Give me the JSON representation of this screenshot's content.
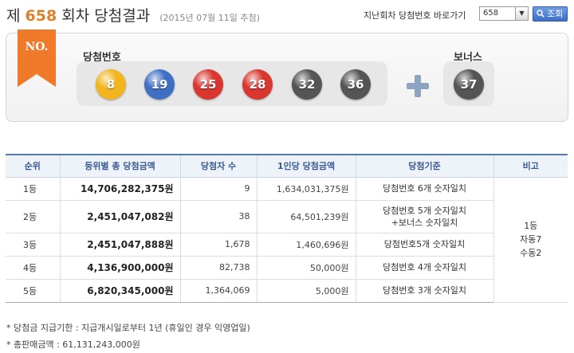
{
  "header": {
    "title_prefix": "제",
    "round": "658",
    "title_suffix": "회차 당첨결과",
    "draw_date": "(2015년 07월 11일 추첨)",
    "goto_label": "지난회차 당첨번호 바로가기",
    "goto_value": "658",
    "search_label": "조회"
  },
  "numbers": {
    "ribbon_text": "NO.",
    "win_label": "당첨번호",
    "bonus_label": "보너스",
    "balls": [
      {
        "value": "8",
        "color": "#f2b51e"
      },
      {
        "value": "19",
        "color": "#3f6fc4"
      },
      {
        "value": "25",
        "color": "#d9362f"
      },
      {
        "value": "28",
        "color": "#d9362f"
      },
      {
        "value": "32",
        "color": "#555555"
      },
      {
        "value": "36",
        "color": "#555555"
      }
    ],
    "bonus": {
      "value": "37",
      "color": "#555555"
    }
  },
  "table": {
    "headers": [
      "순위",
      "등위별 총 당첨금액",
      "당첨자 수",
      "1인당 당첨금액",
      "당첨기준",
      "비고"
    ],
    "rows": [
      {
        "rank": "1등",
        "total": "14,706,282,375원",
        "winners": "9",
        "per": "1,634,031,375원",
        "crit1": "당첨번호 6개 숫자일치",
        "crit2": ""
      },
      {
        "rank": "2등",
        "total": "2,451,047,082원",
        "winners": "38",
        "per": "64,501,239원",
        "crit1": "당첨번호 5개 숫자일치",
        "crit2": "+보너스 숫자일치"
      },
      {
        "rank": "3등",
        "total": "2,451,047,888원",
        "winners": "1,678",
        "per": "1,460,696원",
        "crit1": "당첨번호5개 숫자일치",
        "crit2": ""
      },
      {
        "rank": "4등",
        "total": "4,136,900,000원",
        "winners": "82,738",
        "per": "50,000원",
        "crit1": "당첨번호 4개 숫자일치",
        "crit2": ""
      },
      {
        "rank": "5등",
        "total": "6,820,345,000원",
        "winners": "1,364,069",
        "per": "5,000원",
        "crit1": "당첨번호 3개 숫자일치",
        "crit2": ""
      }
    ],
    "note_lines": [
      "1등",
      "자동7",
      "수동2"
    ]
  },
  "footnotes": [
    "* 당첨금 지급기한 : 지급개시일로부터 1년 (휴일인 경우 익영업일)",
    "* 총판매금액 : 61,131,243,000원"
  ]
}
